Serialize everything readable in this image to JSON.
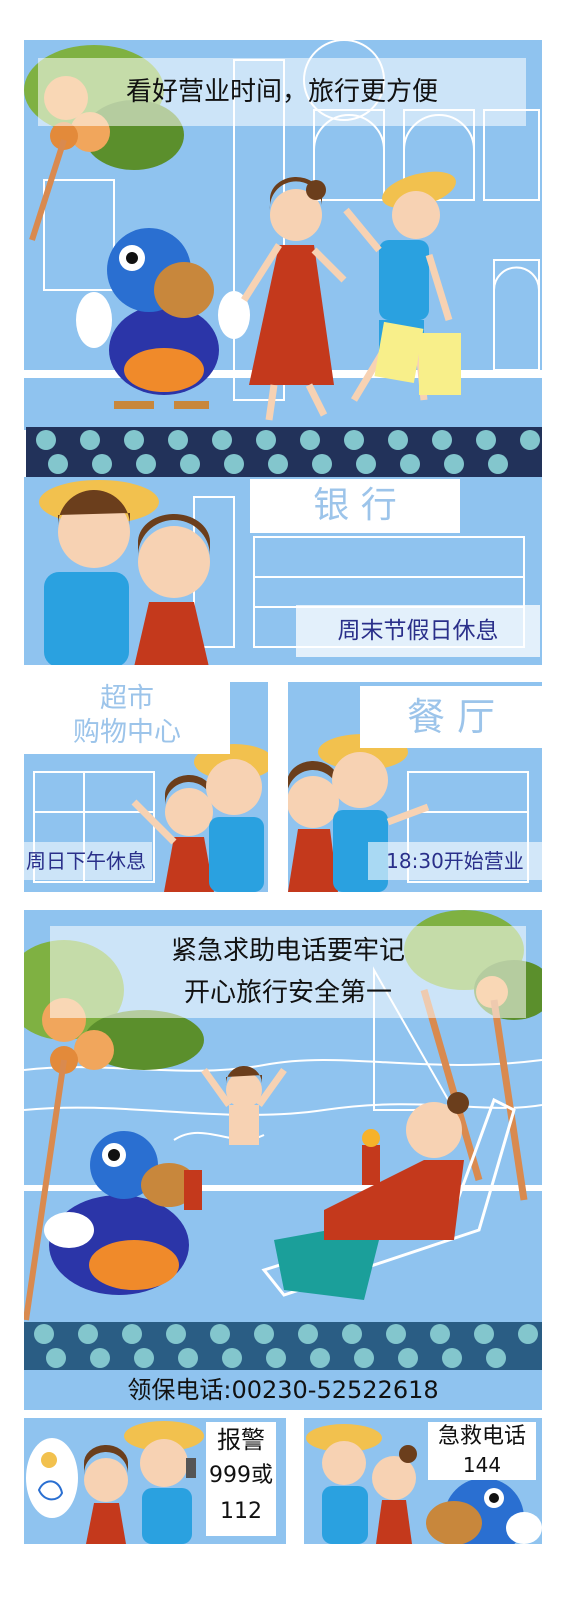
{
  "colors": {
    "sky": "#8fc3ef",
    "navy": "#22325a",
    "dot": "#83c6cd",
    "text_blue": "#2a2f8a",
    "sign_blue": "#9cc4ea"
  },
  "panel1": {
    "caption": "看好营业时间，旅行更方便"
  },
  "panel2": {
    "sign": "银 行",
    "note": "周末节假日休息"
  },
  "panel3": {
    "sign_line1": "超市",
    "sign_line2": "购物中心",
    "note": "周日下午休息"
  },
  "panel4": {
    "sign": "餐 厅",
    "note": "18:30开始营业"
  },
  "panel5": {
    "caption_line1": "紧急求助电话要牢记",
    "caption_line2": "开心旅行安全第一"
  },
  "consulate": {
    "text": "领保电话:00230-52522618"
  },
  "panel6": {
    "line1": "报警",
    "line2": "999或",
    "line3": "112"
  },
  "panel7": {
    "line1": "急救电话",
    "line2": "144"
  }
}
